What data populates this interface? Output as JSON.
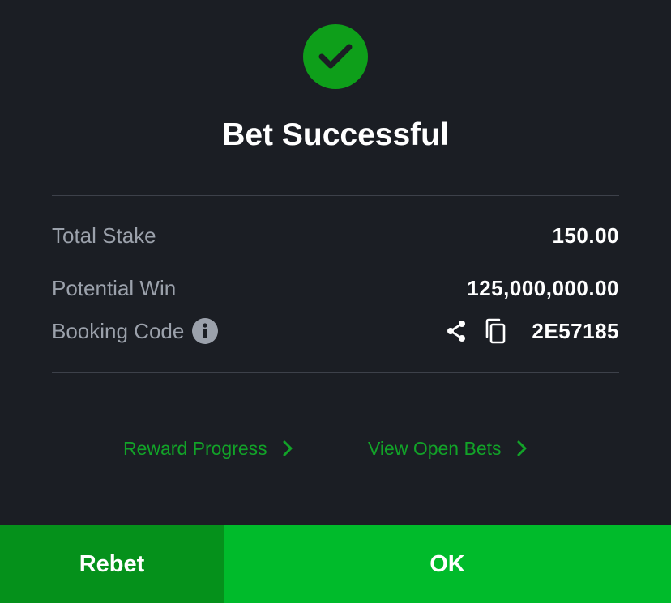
{
  "header": {
    "title": "Bet Successful",
    "icon": "check-circle-icon"
  },
  "summary": {
    "total_stake_label": "Total Stake",
    "total_stake_value": "150.00",
    "potential_win_label": "Potential Win",
    "potential_win_value": "125,000,000.00",
    "booking_code_label": "Booking Code",
    "booking_code_value": "2E57185"
  },
  "links": {
    "reward_progress": "Reward Progress",
    "view_open_bets": "View Open Bets"
  },
  "buttons": {
    "rebet": "Rebet",
    "ok": "OK"
  },
  "colors": {
    "background": "#1b1e24",
    "success_green": "#0e9f1a",
    "link_green": "#12a328",
    "rebet_green": "#05911b",
    "ok_green": "#00bb2b",
    "muted_text": "#9ba1ab"
  }
}
